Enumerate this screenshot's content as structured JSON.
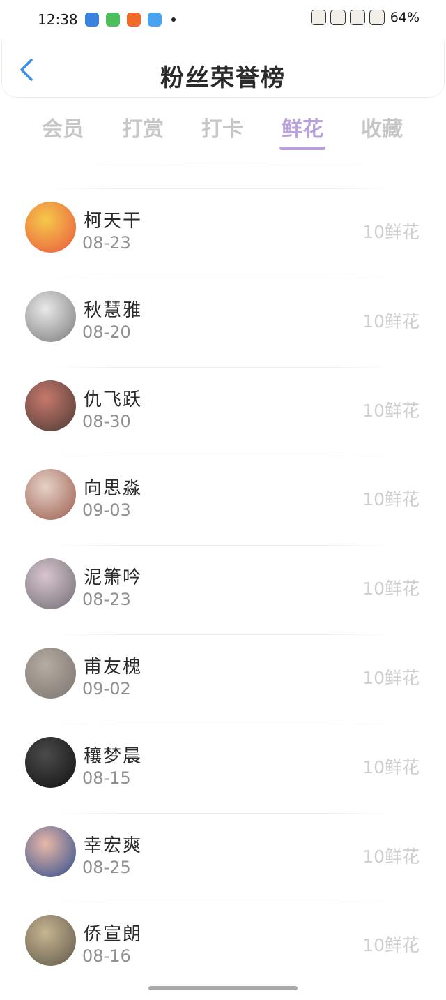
{
  "status": {
    "time": "12:38",
    "battery": "64%",
    "app_colors": [
      "#3b82e0",
      "#4cbf5a",
      "#f06a2a",
      "#4aa3f0"
    ]
  },
  "header": {
    "title": "粉丝荣誉榜",
    "back_icon": "chevron-left-icon"
  },
  "tabs": [
    {
      "label": "会员",
      "active": false
    },
    {
      "label": "打赏",
      "active": false
    },
    {
      "label": "打卡",
      "active": false
    },
    {
      "label": "鲜花",
      "active": true
    },
    {
      "label": "收藏",
      "active": false
    }
  ],
  "colors": {
    "accent": "#b9a2dc",
    "back": "#3a8fe8",
    "muted": "#c6c6c6"
  },
  "fans": [
    {
      "name": "柯天干",
      "date": "08-23",
      "count": "10鲜花",
      "avatar_colors": [
        "#f6c94a",
        "#e8573f"
      ]
    },
    {
      "name": "秋慧雅",
      "date": "08-20",
      "count": "10鲜花",
      "avatar_colors": [
        "#e9e9e9",
        "#7a7a7a"
      ]
    },
    {
      "name": "仇飞跃",
      "date": "08-30",
      "count": "10鲜花",
      "avatar_colors": [
        "#c8786c",
        "#4a3a34"
      ]
    },
    {
      "name": "向思淼",
      "date": "09-03",
      "count": "10鲜花",
      "avatar_colors": [
        "#e6d2c8",
        "#9b5b4c"
      ]
    },
    {
      "name": "泥箫吟",
      "date": "08-23",
      "count": "10鲜花",
      "avatar_colors": [
        "#d9c4cf",
        "#6f6e72"
      ]
    },
    {
      "name": "甫友槐",
      "date": "09-02",
      "count": "10鲜花",
      "avatar_colors": [
        "#b5aca3",
        "#7b746d"
      ]
    },
    {
      "name": "穰梦晨",
      "date": "08-15",
      "count": "10鲜花",
      "avatar_colors": [
        "#4b4b4b",
        "#111111"
      ]
    },
    {
      "name": "幸宏爽",
      "date": "08-25",
      "count": "10鲜花",
      "avatar_colors": [
        "#e8b8a8",
        "#2b4c8c"
      ]
    },
    {
      "name": "侨宣朗",
      "date": "08-16",
      "count": "10鲜花",
      "avatar_colors": [
        "#c8b592",
        "#5d5748"
      ]
    }
  ]
}
